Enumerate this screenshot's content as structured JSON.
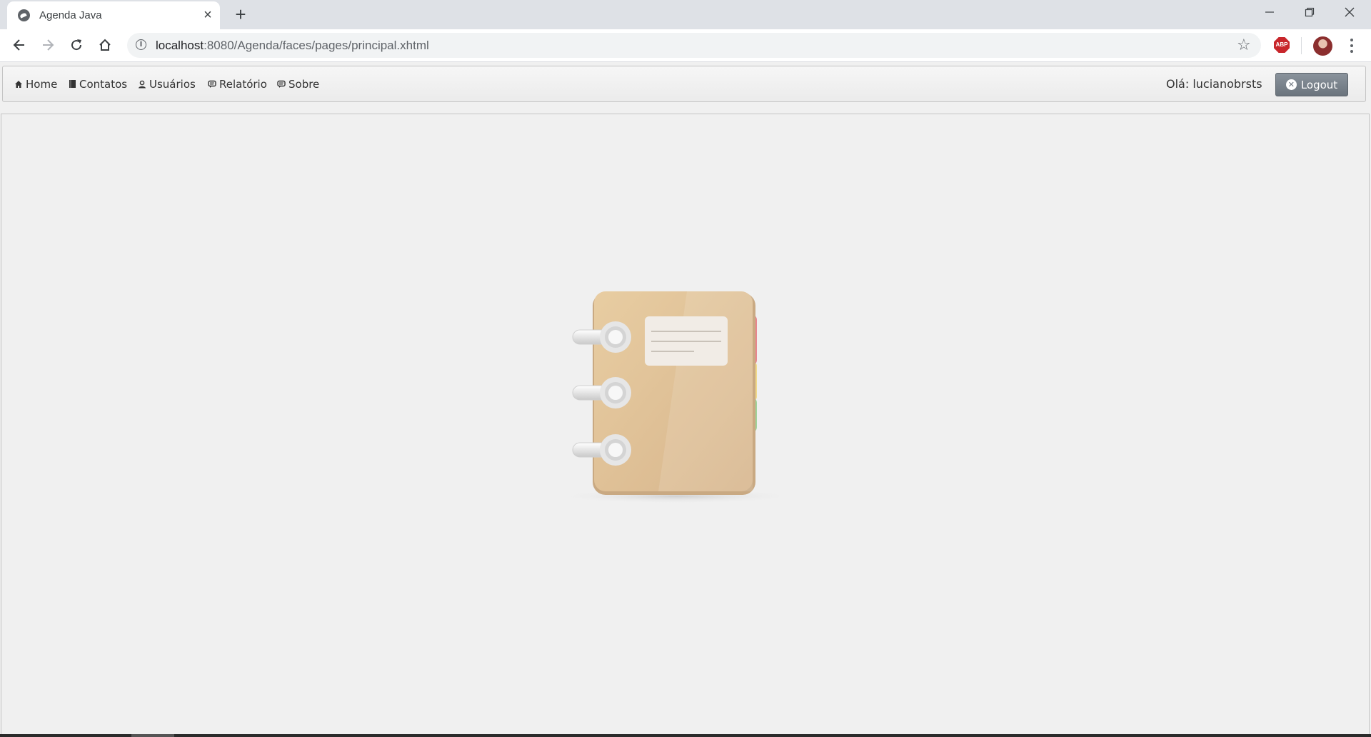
{
  "browser": {
    "tab_title": "Agenda Java",
    "url_host": "localhost",
    "url_rest": ":8080/Agenda/faces/pages/principal.xhtml",
    "abp_label": "ABP"
  },
  "menubar": {
    "items": [
      {
        "label": "Home",
        "icon": "home-icon"
      },
      {
        "label": "Contatos",
        "icon": "book-icon"
      },
      {
        "label": "Usuários",
        "icon": "user-icon"
      },
      {
        "label": "Relatório",
        "icon": "comment-icon"
      },
      {
        "label": "Sobre",
        "icon": "comment-icon"
      }
    ],
    "greeting": "Olá: lucianobrsts",
    "logout_label": "Logout"
  },
  "colors": {
    "menubar_bg": "#ebebeb",
    "logout_bg": "#6b747d",
    "notebook_cover": "#e3c398",
    "tab_red": "#e8868f",
    "tab_yellow": "#f0d98a",
    "tab_green": "#9fd39a"
  }
}
